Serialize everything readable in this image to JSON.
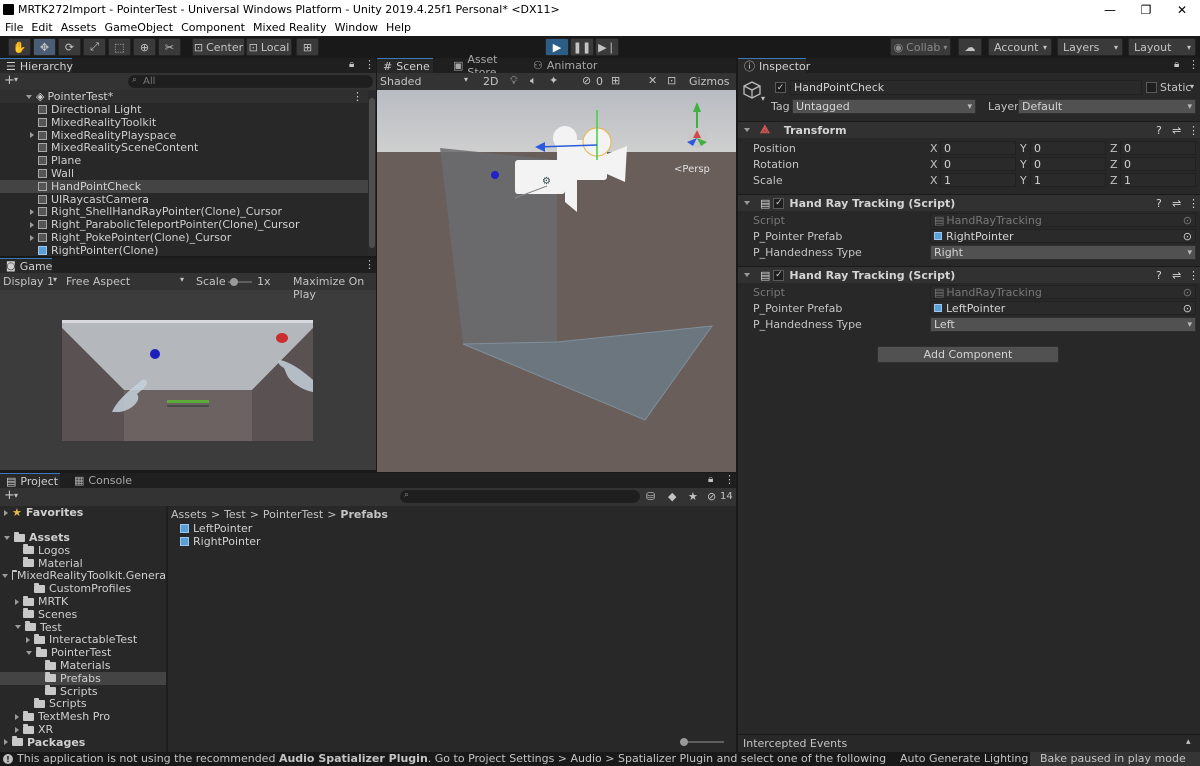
{
  "window": {
    "title": "MRTK272Import - PointerTest - Universal Windows Platform - Unity 2019.4.25f1 Personal* <DX11>",
    "minimize_glyph": "—",
    "restore_glyph": "❐",
    "close_glyph": "✕"
  },
  "menu": [
    "File",
    "Edit",
    "Assets",
    "GameObject",
    "Component",
    "Mixed Reality",
    "Window",
    "Help"
  ],
  "toolbar": {
    "center_label": "Center",
    "local_label": "Local",
    "collab_label": "Collab",
    "account_label": "Account",
    "layers_label": "Layers",
    "layout_label": "Layout"
  },
  "hierarchy": {
    "tab": "Hierarchy",
    "search_placeholder": "All",
    "scene": "PointerTest*",
    "items": [
      "Directional Light",
      "MixedRealityToolkit",
      "MixedRealityPlayspace",
      "MixedRealitySceneContent",
      "Plane",
      "Wall",
      "HandPointCheck",
      "UIRaycastCamera",
      "Right_ShellHandRayPointer(Clone)_Cursor",
      "Right_ParabolicTeleportPointer(Clone)_Cursor",
      "Right_PokePointer(Clone)_Cursor",
      "RightPointer(Clone)"
    ]
  },
  "scene": {
    "tabs": [
      "Scene",
      "Asset Store",
      "Animator"
    ],
    "shading": "Shaded",
    "mode_2d": "2D",
    "hidden_count": "0",
    "gizmos": "Gizmos",
    "persp": "Persp"
  },
  "game": {
    "tab": "Game",
    "display": "Display 1",
    "aspect": "Free Aspect",
    "scale_label": "Scale",
    "scale_value": "1x",
    "maximize": "Maximize On Play"
  },
  "project": {
    "tabs": [
      "Project",
      "Console"
    ],
    "favorites": "Favorites",
    "tree": [
      {
        "label": "Assets",
        "indent": 0,
        "arrow": "down",
        "bold": true
      },
      {
        "label": "Logos",
        "indent": 1,
        "arrow": ""
      },
      {
        "label": "Material",
        "indent": 1,
        "arrow": ""
      },
      {
        "label": "MixedRealityToolkit.Genera",
        "indent": 1,
        "arrow": "down"
      },
      {
        "label": "CustomProfiles",
        "indent": 2,
        "arrow": ""
      },
      {
        "label": "MRTK",
        "indent": 1,
        "arrow": "right"
      },
      {
        "label": "Scenes",
        "indent": 1,
        "arrow": ""
      },
      {
        "label": "Test",
        "indent": 1,
        "arrow": "down"
      },
      {
        "label": "InteractableTest",
        "indent": 2,
        "arrow": "right"
      },
      {
        "label": "PointerTest",
        "indent": 2,
        "arrow": "down"
      },
      {
        "label": "Materials",
        "indent": 3,
        "arrow": ""
      },
      {
        "label": "Prefabs",
        "indent": 3,
        "arrow": "",
        "selected": true
      },
      {
        "label": "Scripts",
        "indent": 3,
        "arrow": ""
      },
      {
        "label": "Scripts",
        "indent": 2,
        "arrow": ""
      },
      {
        "label": "TextMesh Pro",
        "indent": 1,
        "arrow": "right"
      },
      {
        "label": "XR",
        "indent": 1,
        "arrow": "right"
      },
      {
        "label": "Packages",
        "indent": 0,
        "arrow": "right",
        "bold": true
      }
    ],
    "breadcrumb": [
      "Assets",
      "Test",
      "PointerTest",
      "Prefabs"
    ],
    "files": [
      "LeftPointer",
      "RightPointer"
    ],
    "hidden_count": "14"
  },
  "inspector": {
    "tab": "Inspector",
    "object_name": "HandPointCheck",
    "static_label": "Static",
    "tag_label": "Tag",
    "tag_value": "Untagged",
    "layer_label": "Layer",
    "layer_value": "Default",
    "transform": {
      "title": "Transform",
      "rows": [
        {
          "label": "Position",
          "x": "0",
          "y": "0",
          "z": "0"
        },
        {
          "label": "Rotation",
          "x": "0",
          "y": "0",
          "z": "0"
        },
        {
          "label": "Scale",
          "x": "1",
          "y": "1",
          "z": "1"
        }
      ]
    },
    "components": [
      {
        "title": "Hand Ray Tracking (Script)",
        "script_label": "Script",
        "script_value": "HandRayTracking",
        "prefab_label": "P_Pointer Prefab",
        "prefab_value": "RightPointer",
        "hand_label": "P_Handedness Type",
        "hand_value": "Right"
      },
      {
        "title": "Hand Ray Tracking (Script)",
        "script_label": "Script",
        "script_value": "HandRayTracking",
        "prefab_label": "P_Pointer Prefab",
        "prefab_value": "LeftPointer",
        "hand_label": "P_Handedness Type",
        "hand_value": "Left"
      }
    ],
    "add_component": "Add Component",
    "intercepted": "Intercepted Events"
  },
  "status": {
    "message_pre": "This application is not using the recommended ",
    "message_bold": "Audio Spatializer Plugin",
    "message_post": ". Go to Project Settings > Audio > Spatializer Plugin and select one of the following: MS HRTF Spatializer, Microsoft S",
    "auto_lighting": "Auto Generate Lighting Off",
    "bake": "Bake paused in play mode"
  }
}
